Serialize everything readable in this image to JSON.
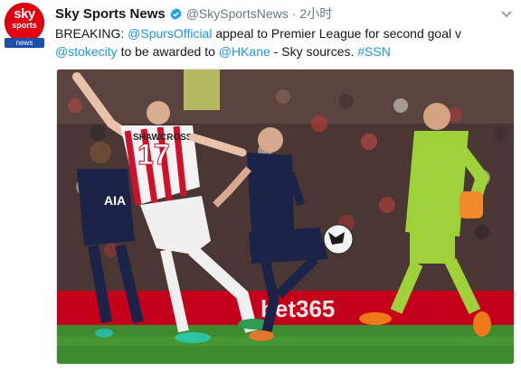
{
  "tweet": {
    "display_name": "Sky Sports News",
    "handle": "@SkySportsNews",
    "separator": "·",
    "time": "2小时",
    "avatar": {
      "line1": "sky",
      "line2": "sports",
      "line3": "news",
      "brand_color": "#e10010"
    },
    "verified_icon": "verified-badge-icon",
    "menu_icon": "chevron-down-icon",
    "text": {
      "part1": "BREAKING: ",
      "mention1": "@SpursOfficial",
      "part2": " appeal to Premier League for second goal v",
      "mention2": "@stokecity",
      "part3": " to be awarded to ",
      "mention3": "@HKane",
      "part4": " - Sky sources. ",
      "hashtag": "#SSN"
    },
    "media": {
      "kind": "photo",
      "jersey_number": "17",
      "jersey_text": "SHAWCROSS"
    },
    "colors": {
      "link": "#1b95e0",
      "name": "#14171a",
      "meta": "#657786"
    }
  }
}
